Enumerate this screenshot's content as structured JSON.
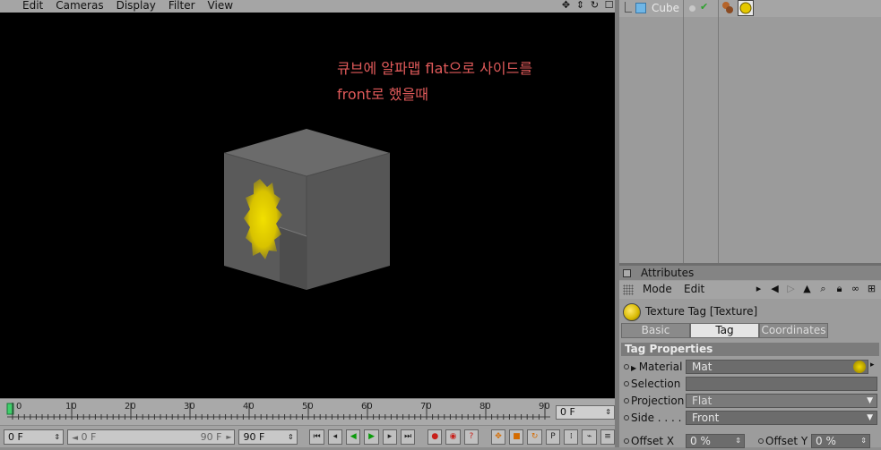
{
  "viewport": {
    "menu": [
      "Edit",
      "Cameras",
      "Display",
      "Filter",
      "View"
    ],
    "annotation_line1": "큐브에 알파맵 flat으로 사이드를",
    "annotation_line2": "front로 했을때"
  },
  "timeline": {
    "ticks": [
      "0",
      "10",
      "20",
      "30",
      "40",
      "50",
      "60",
      "70",
      "80",
      "90"
    ],
    "current_frame": "0 F"
  },
  "transport": {
    "start_field": "0 F",
    "range_start": "0 F",
    "range_end": "90 F",
    "end_field": "90 F"
  },
  "object_manager": {
    "object_name": "Cube"
  },
  "attributes": {
    "header": "Attributes",
    "menu_mode": "Mode",
    "menu_edit": "Edit",
    "tag_title": "Texture Tag [Texture]",
    "tabs": [
      "Basic",
      "Tag",
      "Coordinates"
    ],
    "section_title": "Tag Properties",
    "material_label": "Material",
    "material_value": "Mat",
    "selection_label": "Selection",
    "selection_value": "",
    "projection_label": "Projection",
    "projection_value": "Flat",
    "side_label": "Side . . . . .",
    "side_value": "Front",
    "offset_x_label": "Offset X",
    "offset_x_value": "0 %",
    "offset_y_label": "Offset Y",
    "offset_y_value": "0 %"
  },
  "colors": {
    "annotation": "#e05a5a",
    "viewport_bg": "#000000",
    "texture_yellow": "#e6d000"
  }
}
